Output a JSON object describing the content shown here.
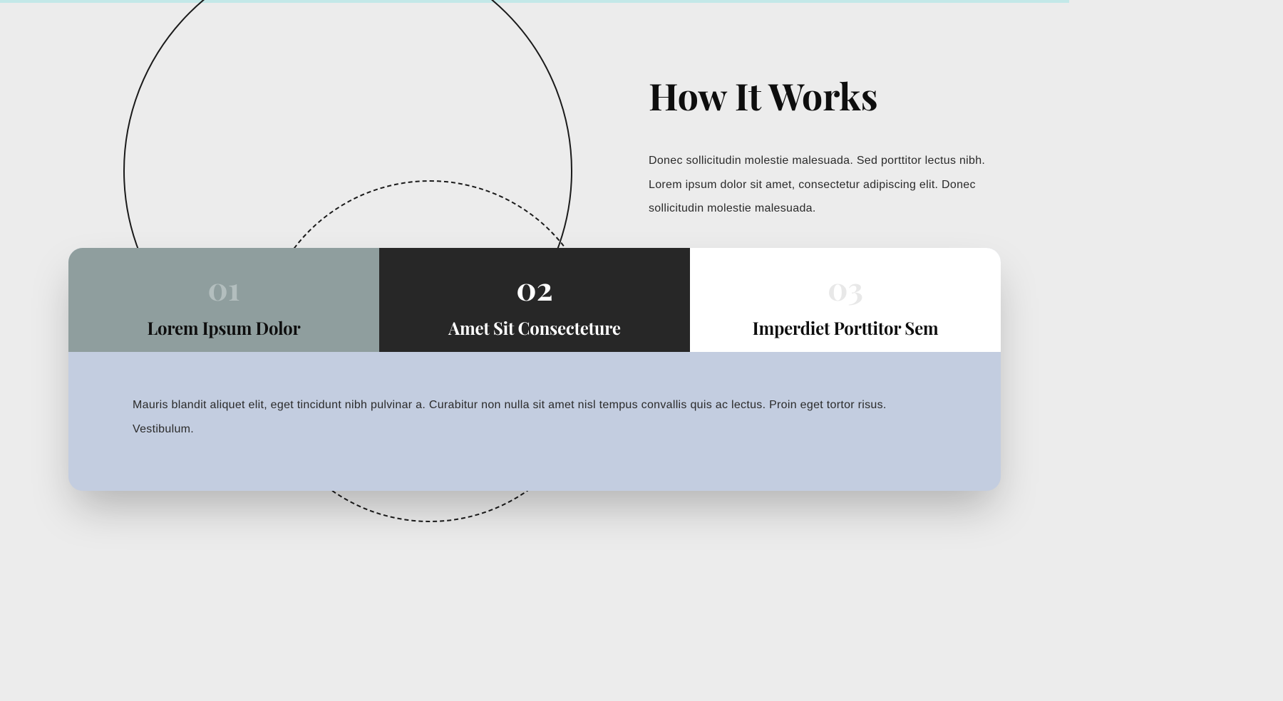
{
  "header": {
    "title": "How It Works",
    "description": "Donec sollicitudin molestie malesuada. Sed porttitor lectus nibh. Lorem ipsum dolor sit amet, consectetur adipiscing elit. Donec sollicitudin molestie malesuada."
  },
  "tabs": [
    {
      "number": "01",
      "title": "Lorem Ipsum Dolor"
    },
    {
      "number": "02",
      "title": "Amet Sit Consecteture"
    },
    {
      "number": "03",
      "title": "Imperdiet Porttitor Sem"
    }
  ],
  "tab_content": "Mauris blandit aliquet elit, eget tincidunt nibh pulvinar a. Curabitur non nulla sit amet nisl tempus convallis quis ac lectus. Proin eget tortor risus. Vestibulum."
}
